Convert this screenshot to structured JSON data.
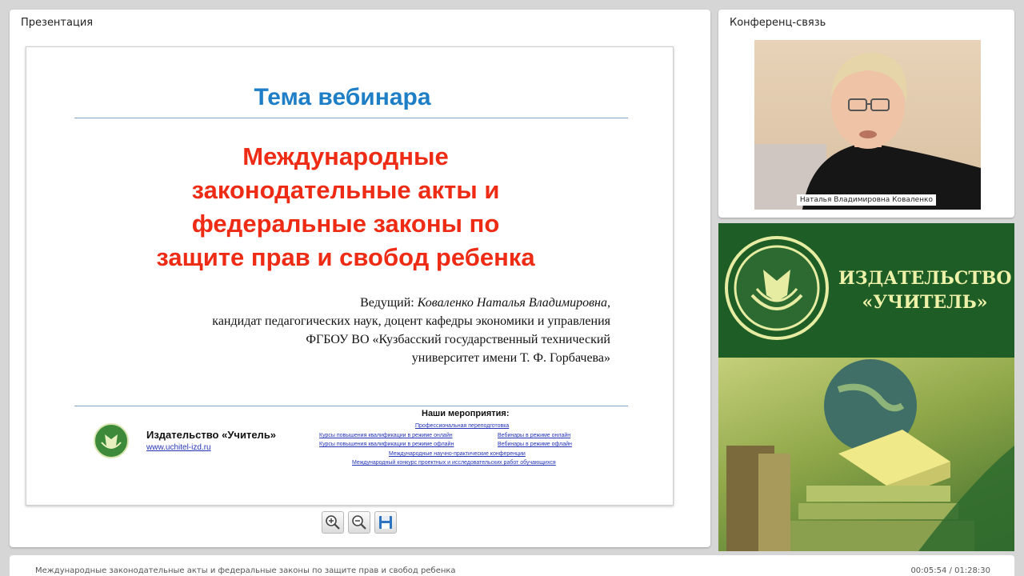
{
  "presentation_panel": {
    "title": "Презентация"
  },
  "slide": {
    "heading": "Тема вебинара",
    "topic_lines": [
      "Международные",
      "законодательные акты и",
      "федеральные законы по",
      "защите прав и свобод ребенка"
    ],
    "presenter_label": "Ведущий:",
    "presenter_name": "Коваленко Наталья Владимировна",
    "presenter_lines": [
      "кандидат педагогических наук, доцент кафедры экономики и управления",
      "ФГБОУ ВО «Кузбасский государственный технический",
      "университет имени Т. Ф. Горбачева»"
    ],
    "publisher_name": "Издательство «Учитель»",
    "publisher_url": "www.uchitel-izd.ru",
    "events_title": "Наши мероприятия",
    "events": {
      "retraining": "Профессиональная переподготовка",
      "courses_online": "Курсы повышения квалификации в режиме онлайн",
      "webinars_online": "Вебинары в режиме онлайн",
      "courses_offline": "Курсы повышения квалификации в режиме офлайн",
      "webinars_offline": "Вебинары в режиме офлайн",
      "conferences": "Международные научно-практические конференции",
      "contest": "Международный конкурс проектных и исследовательских работ обучающихся"
    }
  },
  "toolbar": {
    "zoom_in_icon": "zoom-in-icon",
    "zoom_out_icon": "zoom-out-icon",
    "save_icon": "floppy-disk-icon"
  },
  "conference_panel": {
    "title": "Конференц-связь",
    "participant_name": "Наталья Владимировна Коваленко"
  },
  "ad_banner": {
    "line1": "ИЗДАТЕЛЬСТВО",
    "line2": "«УЧИТЕЛЬ»"
  },
  "status_bar": {
    "webinar_title": "Международные законодательные акты и федеральные законы по защите прав и свобод ребенка",
    "time": "00:05:54 / 01:28:30"
  },
  "colors": {
    "heading_blue": "#1e7fc7",
    "topic_red": "#ee2b14",
    "link_blue": "#2433b8",
    "ad_green": "#1f5d27",
    "ad_text": "#eef2a8"
  }
}
